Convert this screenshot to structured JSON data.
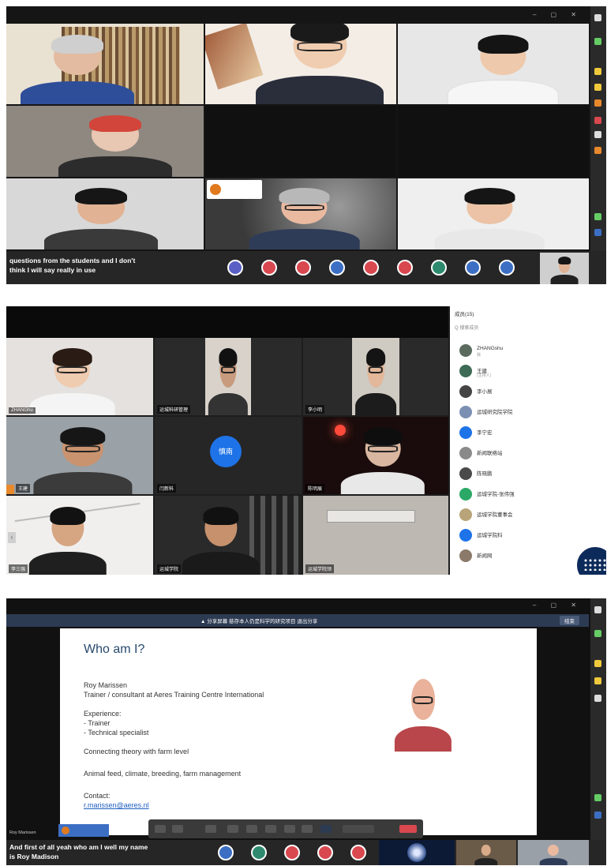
{
  "screenshots": [
    {
      "caption": [
        "questions from the students and I don't",
        "think I will say really in use"
      ],
      "reaction_colors": [
        "#5a5fc6",
        "#d9484f",
        "#d9484f",
        "#3c6fc4",
        "#d9484f",
        "#d9484f",
        "#2e8a6e",
        "#3c6fc4",
        "#3c6fc4"
      ]
    },
    {
      "panel_header": "成员(15)",
      "panel_search": "Q 搜索成员",
      "tile_names": [
        "ZHANGhu",
        "运城科研管理",
        "李小明",
        "王建",
        "闫新科",
        "陈明展",
        "李三强",
        "运城学院",
        "运城学院领"
      ],
      "center_avatar_label": "慎南",
      "members": [
        {
          "name": "ZHANGshu",
          "sub": "我",
          "color": "#5b6b5e"
        },
        {
          "name": "王建",
          "sub": "(主持人)",
          "color": "#3d6b55"
        },
        {
          "name": "李小展",
          "sub": "",
          "color": "#444444"
        },
        {
          "name": "运城研究院学院",
          "sub": "",
          "color": "#7b8fb3"
        },
        {
          "name": "李宁宏",
          "sub": "",
          "color": "#1e73e8"
        },
        {
          "name": "新闻联络站",
          "sub": "",
          "color": "#8a8a8a"
        },
        {
          "name": "陈晓鹏",
          "sub": "",
          "color": "#4a4a4a"
        },
        {
          "name": "运城学院-张伟强",
          "sub": "",
          "color": "#2aa865"
        },
        {
          "name": "运城学院董事会",
          "sub": "",
          "color": "#b8a478"
        },
        {
          "name": "运城学院科",
          "sub": "",
          "color": "#1e73e8"
        },
        {
          "name": "新闻网",
          "sub": "",
          "color": "#8b7a6a"
        }
      ]
    },
    {
      "top_bar_text": "▲ 分享屏幕  慈存本人仍是科学的研究项目  退出分享",
      "top_bar_button": "结束",
      "slide": {
        "title": "Who am I?",
        "name": "Roy Marissen",
        "role": "Trainer / consultant at Aeres Training Centre International",
        "experience_label": "Experience:",
        "experience_items": [
          "- Trainer",
          "- Technical specialist"
        ],
        "line1": "Connecting theory with farm level",
        "line2": "Animal feed, climate, breeding, farm management",
        "contact_label": "Contact:",
        "contact_email": "r.marissen@aeres.nl"
      },
      "speaker_tag": "Roy Marissen",
      "caption": [
        "And first of all yeah who am I well my name",
        "is Roy Madison"
      ],
      "reaction_colors": [
        "#3c6fc4",
        "#2e8a6e",
        "#d9484f",
        "#d9484f",
        "#d9484f"
      ]
    }
  ]
}
